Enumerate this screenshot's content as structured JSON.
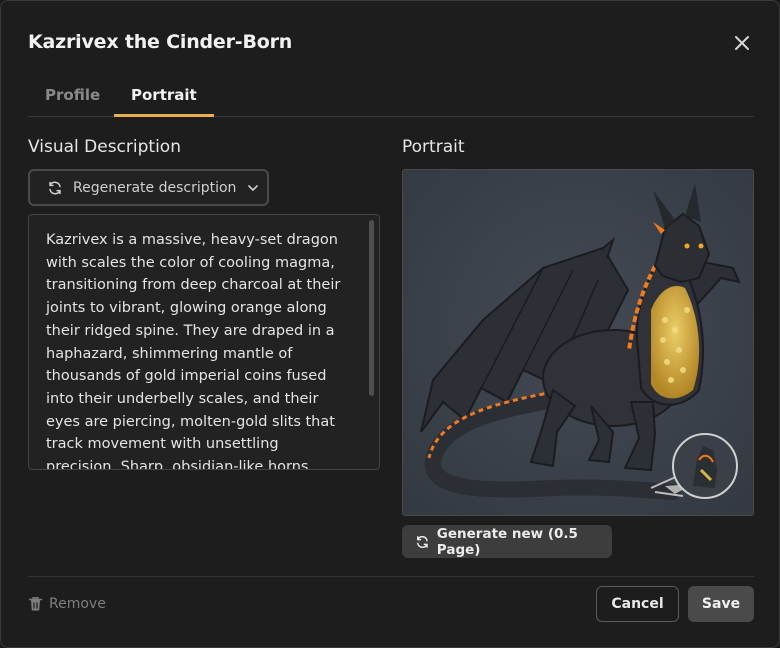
{
  "dialog": {
    "title": "Kazrivex the Cinder-Born"
  },
  "tabs": [
    {
      "label": "Profile",
      "active": false
    },
    {
      "label": "Portrait",
      "active": true
    }
  ],
  "visual_description": {
    "heading": "Visual Description",
    "regenerate_label": "Regenerate description",
    "text": "Kazrivex is a massive, heavy-set dragon with scales the color of cooling magma, transitioning from deep charcoal at their joints to vibrant, glowing orange along their ridged spine. They are draped in a haphazard, shimmering mantle of thousands of gold imperial coins fused into their underbelly scales, and their eyes are piercing, molten-gold slits that track movement with unsettling precision. Sharp, obsidian-like horns crown their"
  },
  "portrait": {
    "heading": "Portrait",
    "generate_label": "Generate new (0.5 Page)"
  },
  "footer": {
    "remove_label": "Remove",
    "cancel_label": "Cancel",
    "save_label": "Save"
  },
  "colors": {
    "accent": "#e8b04a",
    "background": "#1d1d1d",
    "portrait_bg": "#3a4049",
    "ember": "#f07a1c"
  },
  "icons": {
    "close": "close-icon",
    "regenerate": "refresh-icon",
    "dropdown": "chevron-down-icon",
    "remove": "trash-icon"
  }
}
